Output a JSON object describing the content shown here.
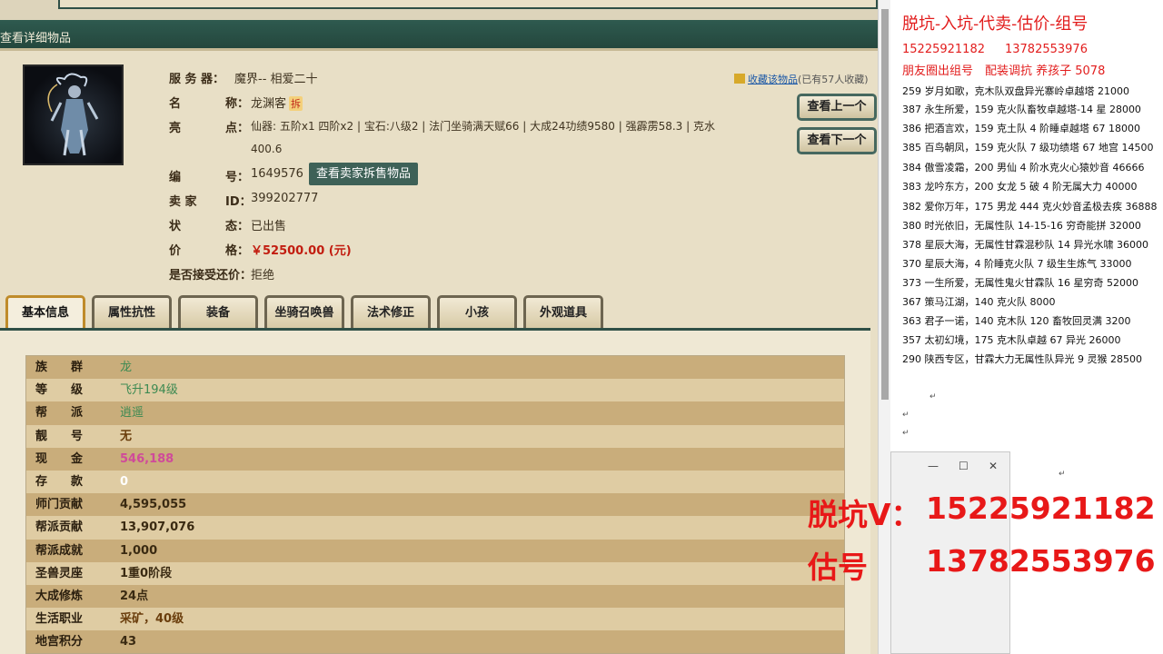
{
  "window": {
    "title": "查看详细物品"
  },
  "item": {
    "fav_link": "收藏该物品",
    "fav_count": "(已有57人收藏)",
    "server_label": "服 务 器：",
    "server_value": "魔界-- 相爱二十",
    "name_label_a": "名",
    "name_label_b": "称：",
    "name_value": "龙渊客",
    "name_badge": "拆",
    "highlight_label_a": "亮",
    "highlight_label_b": "点：",
    "highlight_value_1": "仙器: 五阶x1 四阶x2 | 宝石:八级2 | 法门坐骑满天赋66 | 大成24功绩9580 | 强霹雳58.3 | 克水",
    "highlight_value_2": "400.6",
    "id_label_a": "编",
    "id_label_b": "号：",
    "id_value": "1649576",
    "seller_button": "查看卖家拆售物品",
    "seller_label_a": "卖 家",
    "seller_label_b": "ID：",
    "seller_value": "399202777",
    "status_label_a": "状",
    "status_label_b": "态：",
    "status_value": "已出售",
    "price_label_a": "价",
    "price_label_b": "格：",
    "price_value": "￥52500.00 (元)",
    "bargain_label": "是否接受还价：",
    "bargain_value": "拒绝"
  },
  "nav": {
    "prev": "查看上一个",
    "next": "查看下一个"
  },
  "tabs": [
    {
      "label": "基本信息"
    },
    {
      "label": "属性抗性"
    },
    {
      "label": "装备"
    },
    {
      "label": "坐骑召唤兽"
    },
    {
      "label": "法术修正"
    },
    {
      "label": "小孩"
    },
    {
      "label": "外观道具"
    }
  ],
  "attributes": [
    {
      "key": "族　　群",
      "value": "龙"
    },
    {
      "key": "等　　级",
      "value": "飞升194级"
    },
    {
      "key": "帮　　派",
      "value": "逍遥"
    },
    {
      "key": "靓　　号",
      "value": "无"
    },
    {
      "key": "现　　金",
      "value": "546,188"
    },
    {
      "key": "存　　款",
      "value": "0"
    },
    {
      "key": "师门贡献",
      "value": "4,595,055"
    },
    {
      "key": "帮派贡献",
      "value": "13,907,076"
    },
    {
      "key": "帮派成就",
      "value": "1,000"
    },
    {
      "key": "圣兽灵座",
      "value": "1重0阶段"
    },
    {
      "key": "大成修炼",
      "value": "24点"
    },
    {
      "key": "生活职业",
      "value": "采矿，40级"
    },
    {
      "key": "地宫积分",
      "value": "43"
    }
  ],
  "notepad": {
    "title": "脱坑-入坑-代卖-估价-组号",
    "phone_1": "15225921182",
    "phone_2": "13782553976",
    "slogan": "朋友圈出组号　配装调抗 养孩子 5078",
    "lines": [
      "259 岁月如歌，克木队双盘异光寨岭卓越塔 21000",
      "387 永生所爱，159 克火队畜牧卓越塔-14 星 28000",
      "386 把酒言欢，159 克土队 4 阶睡卓越塔 67  18000",
      "385 百鸟朝凤，159 克火队 7 级功绩塔 67 地宫 14500",
      "384 傲雪凌霜，200 男仙 4 阶水克火心猿妙音 46666",
      "383 龙吟东方，200 女龙 5 破 4 阶无属大力 40000",
      "382 爱你万年，175 男龙 444 克火妙音孟极去疾 36888",
      "380 时光依旧，无属性队 14-15-16 穷奇能拼 32000",
      "378 星辰大海，无属性甘霖混秒队 14 异光水啸 36000",
      "370 星辰大海，4 阶睡克火队 7 级生生炼气 33000",
      "373 一生所爱，无属性鬼火甘霖队 16 星穷奇 52000",
      "367 策马江湖，140 克火队 8000",
      "363 君子一诺，140 克木队 120 畜牧回灵满 3200",
      "357 太初幻境，175 克木队卓越 67 异光 26000",
      "290 陕西专区，甘霖大力无属性队异光 9 灵猴 28500"
    ]
  },
  "overlay": {
    "contact_label": "脱坑V：",
    "contact_number": "15225921182",
    "appraise_label": "估号",
    "appraise_number": "13782553976"
  },
  "icons": {
    "fav": "star-folder-icon",
    "minimize": "minimize-icon",
    "maximize": "maximize-icon",
    "close": "close-icon"
  }
}
